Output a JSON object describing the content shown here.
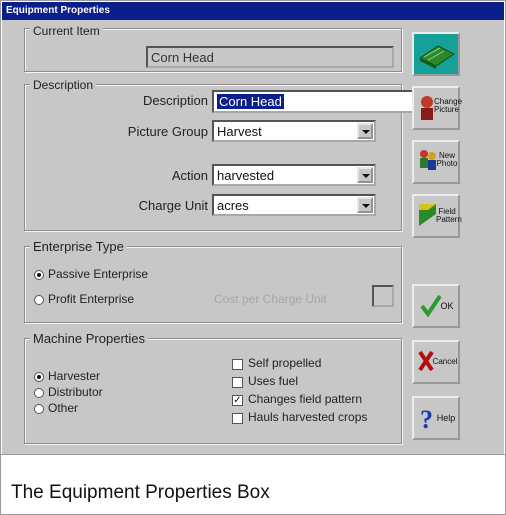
{
  "window": {
    "title": "Equipment Properties"
  },
  "current_item": {
    "group_label": "Current Item",
    "value": "Corn Head"
  },
  "description": {
    "group_label": "Description",
    "description_label": "Description",
    "description_value": "Corn Head",
    "picture_group_label": "Picture Group",
    "picture_group_value": "Harvest",
    "action_label": "Action",
    "action_value": "harvested",
    "charge_unit_label": "Charge Unit",
    "charge_unit_value": "acres"
  },
  "enterprise_type": {
    "group_label": "Enterprise Type",
    "options": [
      {
        "label": "Passive Enterprise",
        "selected": true
      },
      {
        "label": "Profit Enterprise",
        "selected": false
      }
    ],
    "cost_label": "Cost per Charge Unit"
  },
  "machine_properties": {
    "group_label": "Machine Properties",
    "radios": [
      {
        "label": "Harvester",
        "selected": true
      },
      {
        "label": "Distributor",
        "selected": false
      },
      {
        "label": "Other",
        "selected": false
      }
    ],
    "checks": [
      {
        "label": "Self propelled",
        "checked": false
      },
      {
        "label": "Uses fuel",
        "checked": false
      },
      {
        "label": "Changes field pattern",
        "checked": true
      },
      {
        "label": "Hauls harvested crops",
        "checked": false
      }
    ]
  },
  "side_buttons": {
    "change_picture": "Change Picture",
    "new_photo": "New Photo",
    "field_pattern": "Field Pattern",
    "ok": "OK",
    "cancel": "Cancel",
    "help": "Help"
  },
  "caption": "The Equipment Properties Box"
}
